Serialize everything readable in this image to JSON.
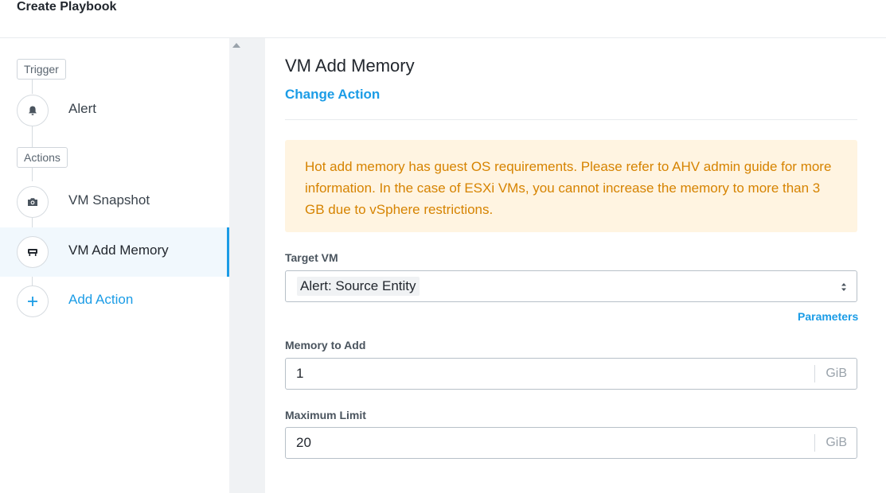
{
  "header": {
    "title": "Create Playbook"
  },
  "sidebar": {
    "trigger_tag": "Trigger",
    "actions_tag": "Actions",
    "steps": [
      {
        "label": "Alert",
        "icon": "bell-icon"
      },
      {
        "label": "VM Snapshot",
        "icon": "camera-icon"
      },
      {
        "label": "VM Add Memory",
        "icon": "memory-icon",
        "active": true
      },
      {
        "label": "Add Action",
        "icon": "plus-icon"
      }
    ]
  },
  "main": {
    "title": "VM Add Memory",
    "change_action": "Change Action",
    "alert_text": "Hot add memory has guest OS requirements. Please refer to AHV admin guide for more information. In the case of ESXi VMs, you cannot increase the memory to more than 3 GB due to vSphere restrictions.",
    "target_vm": {
      "label": "Target VM",
      "value": "Alert: Source Entity"
    },
    "parameters_link": "Parameters",
    "memory_to_add": {
      "label": "Memory to Add",
      "value": "1",
      "unit": "GiB"
    },
    "maximum_limit": {
      "label": "Maximum Limit",
      "value": "20",
      "unit": "GiB"
    }
  },
  "colors": {
    "accent": "#1b9ce6",
    "warning_bg": "#fff4e1",
    "warning_text": "#d68300"
  }
}
